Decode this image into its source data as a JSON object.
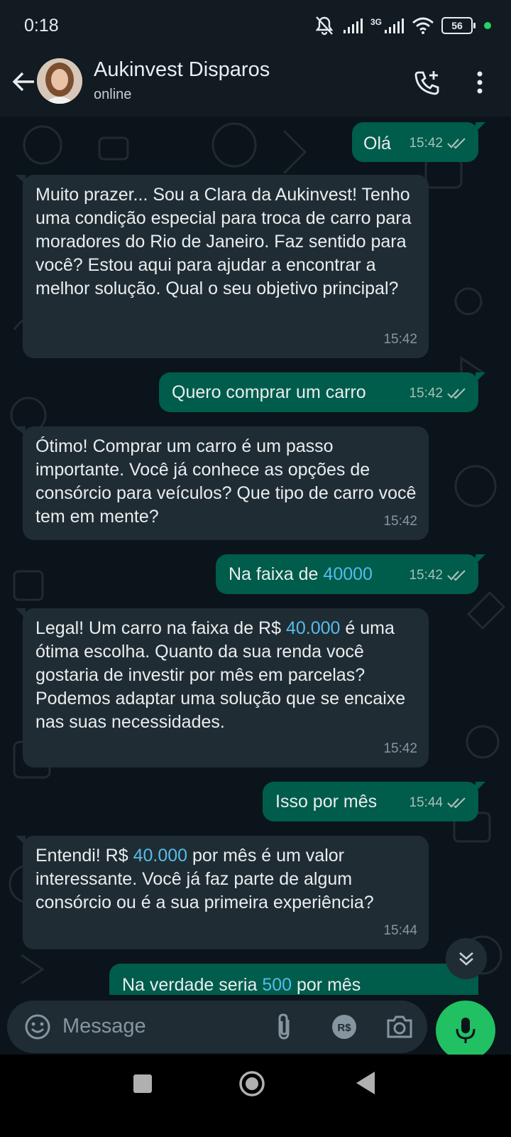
{
  "status_bar": {
    "time": "0:18",
    "network": "3G",
    "battery": "56"
  },
  "header": {
    "contact_name": "Aukinvest Disparos",
    "status": "online"
  },
  "messages": [
    {
      "dir": "out",
      "text": "Olá",
      "time": "15:42"
    },
    {
      "dir": "in",
      "text": "Muito prazer... Sou a Clara da Aukinvest! Tenho uma condição especial para troca de carro para moradores do Rio de Janeiro. Faz sentido para você? Estou aqui para ajudar a encontrar a melhor solução. Qual o seu objetivo principal?",
      "time": "15:42"
    },
    {
      "dir": "out",
      "text": "Quero comprar um carro",
      "time": "15:42"
    },
    {
      "dir": "in",
      "text": "Ótimo! Comprar um carro é um passo importante. Você já conhece as opções de consórcio para veículos? Que tipo de carro você tem em mente?",
      "time": "15:42"
    },
    {
      "dir": "out",
      "text_before": "Na faixa de ",
      "highlight": "40000",
      "time": "15:42"
    },
    {
      "dir": "in",
      "text_before": "Legal! Um carro na faixa de R$ ",
      "highlight": "40.000",
      "text_after": " é uma ótima escolha. Quanto da sua renda você gostaria de investir por mês em parcelas? Podemos adaptar uma solução que se encaixe nas suas necessidades.",
      "time": "15:42"
    },
    {
      "dir": "out",
      "text": "Isso por mês",
      "time": "15:44"
    },
    {
      "dir": "in",
      "text_before": "Entendi! R$ ",
      "highlight": "40.000",
      "text_after": " por mês é um valor interessante. Você já faz parte de algum consórcio ou é a sua primeira experiência?",
      "time": "15:44"
    },
    {
      "dir": "out",
      "text_before": "Na verdade seria ",
      "highlight": "500",
      "text_after": " por mês"
    }
  ],
  "input": {
    "placeholder": "Message"
  },
  "colors": {
    "outgoing": "#005c4b",
    "incoming": "#202c33",
    "background": "#0b141a",
    "accent": "#21c063",
    "link": "#53bdeb"
  },
  "icons": [
    "back-arrow-icon",
    "add-call-icon",
    "more-vert-icon",
    "emoji-icon",
    "attach-icon",
    "payment-icon",
    "camera-icon",
    "mic-icon",
    "double-check-icon",
    "scroll-down-icon"
  ]
}
